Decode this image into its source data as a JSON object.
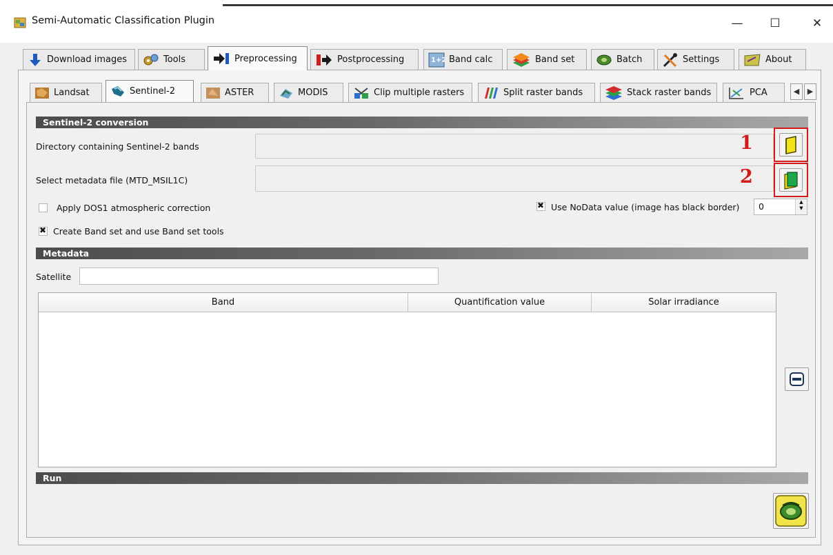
{
  "window": {
    "title": "Semi-Automatic Classification Plugin",
    "minimize_glyph": "—",
    "maximize_glyph": "☐",
    "close_glyph": "✕"
  },
  "main_tabs": [
    {
      "label": "Download images",
      "icon": "download-arrow-icon"
    },
    {
      "label": "Tools",
      "icon": "tools-icon"
    },
    {
      "label": "Preprocessing",
      "icon": "preprocessing-arrow-icon",
      "active": true
    },
    {
      "label": "Postprocessing",
      "icon": "postprocessing-arrow-icon"
    },
    {
      "label": "Band calc",
      "icon": "band-calc-icon"
    },
    {
      "label": "Band set",
      "icon": "band-set-icon"
    },
    {
      "label": "Batch",
      "icon": "batch-icon"
    },
    {
      "label": "Settings",
      "icon": "settings-icon"
    },
    {
      "label": "About",
      "icon": "about-icon"
    }
  ],
  "sub_tabs": [
    {
      "label": "Landsat",
      "icon": "landsat-icon"
    },
    {
      "label": "Sentinel-2",
      "icon": "sentinel-icon",
      "active": true
    },
    {
      "label": "ASTER",
      "icon": "aster-icon"
    },
    {
      "label": "MODIS",
      "icon": "modis-icon"
    },
    {
      "label": "Clip multiple rasters",
      "icon": "clip-icon"
    },
    {
      "label": "Split raster bands",
      "icon": "split-icon"
    },
    {
      "label": "Stack raster bands",
      "icon": "stack-icon"
    },
    {
      "label": "PCA",
      "icon": "pca-icon"
    }
  ],
  "conversion": {
    "section_title": "Sentinel-2 conversion",
    "dir_label": "Directory containing Sentinel-2 bands",
    "dir_value": "",
    "metadata_label": "Select metadata file (MTD_MSIL1C)",
    "metadata_value": "",
    "annotation_1": "1",
    "annotation_2": "2",
    "dos1_label": "Apply DOS1 atmospheric correction",
    "dos1_checked": false,
    "nodata_label": "Use NoData value (image has black border)",
    "nodata_checked": true,
    "nodata_value": "0",
    "bandset_label": "Create Band set and use Band set tools",
    "bandset_checked": true
  },
  "metadata": {
    "section_title": "Metadata",
    "satellite_label": "Satellite",
    "satellite_value": "",
    "table_headers": [
      "Band",
      "Quantification value",
      "Solar irradiance"
    ],
    "rows": []
  },
  "run": {
    "section_title": "Run"
  },
  "colors": {
    "annotation_red": "#d11a1a",
    "section_bar_dark": "#4c4c4c"
  }
}
